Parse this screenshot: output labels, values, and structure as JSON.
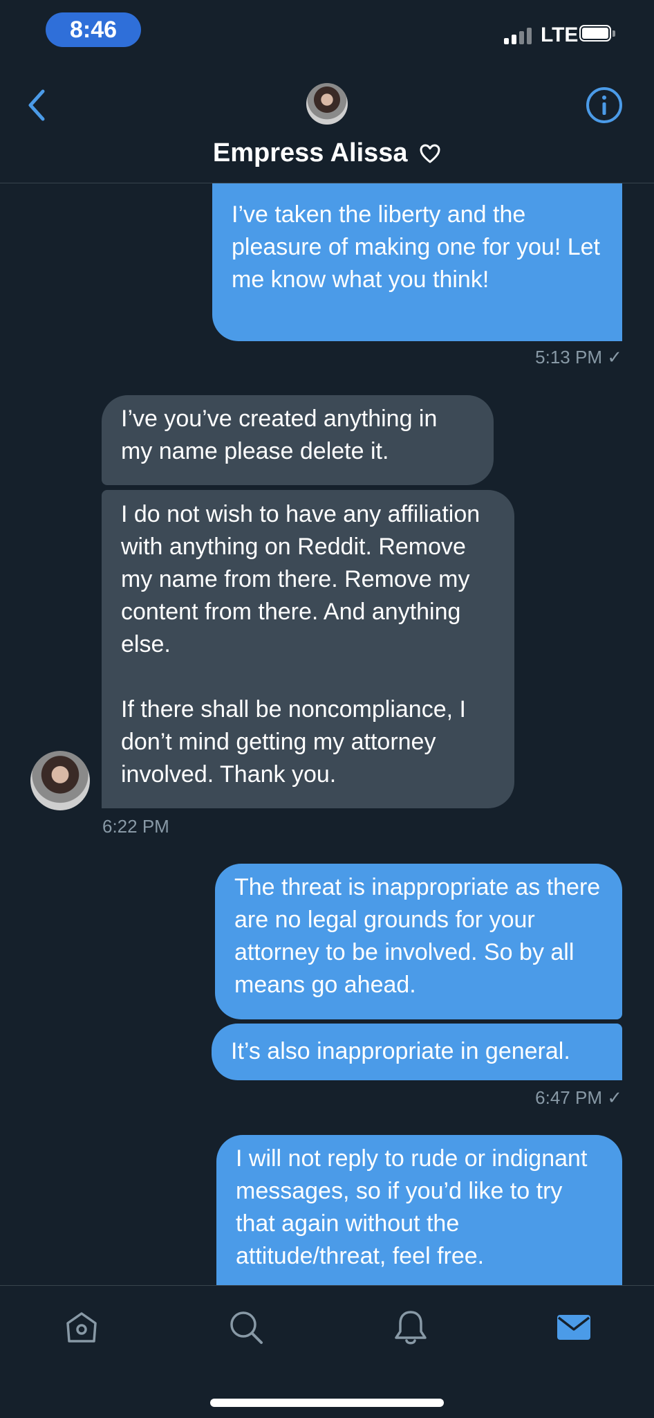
{
  "status_bar": {
    "time": "8:46",
    "network": "LTE"
  },
  "header": {
    "contact_name": "Empress Alissa"
  },
  "messages": [
    {
      "text": "I’ve taken the liberty and the pleasure of making one for you! Let me know what you think!"
    },
    {
      "timestamp": "5:13 PM ✓"
    },
    {
      "text": "I’ve you’ve created anything in my name please delete it."
    },
    {
      "text": "I do not wish to have any affiliation with anything on Reddit. Remove my name from there. Remove my content from there. And anything else.\n\nIf there shall be noncompliance, I don’t mind getting my attorney involved. Thank you."
    },
    {
      "timestamp": "6:22 PM"
    },
    {
      "text": "The threat is inappropriate as there are no legal grounds for your attorney to be involved. So by all means go ahead."
    },
    {
      "text": "It’s also inappropriate in general."
    },
    {
      "timestamp": "6:47 PM ✓"
    },
    {
      "text": "I will not reply to rude or indignant messages, so if you’d like to try that again without the attitude/threat, feel free."
    }
  ],
  "tabs": [
    "home-icon",
    "search-icon",
    "notifications-icon",
    "messages-icon"
  ],
  "colors": {
    "background": "#15202b",
    "sent_bubble": "#4b9be8",
    "received_bubble": "#3d4a56",
    "accent": "#4b9be8",
    "muted": "#8899a6"
  }
}
